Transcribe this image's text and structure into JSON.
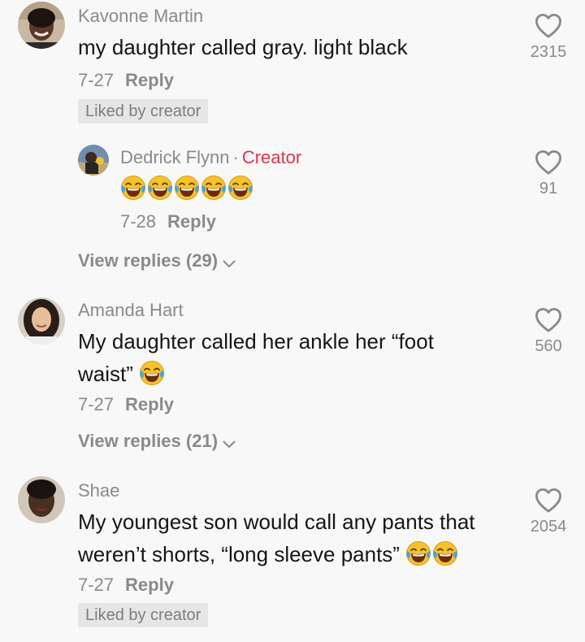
{
  "comments": [
    {
      "author": "Kavonne Martin",
      "text": "my daughter called gray. light black",
      "date": "7-27",
      "reply_label": "Reply",
      "likes": "2315",
      "liked_badge": "Liked by creator"
    },
    {
      "author": "Dedrick Flynn",
      "creator_tag": "Creator",
      "emoji_name": "face-with-tears-of-joy",
      "date": "7-28",
      "reply_label": "Reply",
      "likes": "91"
    },
    {
      "view_replies": "View replies (29)"
    },
    {
      "author": "Amanda Hart",
      "text_line1": "My daughter called her ankle her “foot",
      "text_line2": "waist”",
      "date": "7-27",
      "reply_label": "Reply",
      "likes": "560",
      "view_replies": "View replies (21)"
    },
    {
      "author": "Shae",
      "text_line1": "My youngest son would call any pants that",
      "text_line2": "weren’t shorts, “long sleeve pants”",
      "date": "7-27",
      "reply_label": "Reply",
      "likes": "2054",
      "liked_badge": "Liked by creator"
    }
  ],
  "colors": {
    "background": "#f8f8f8",
    "text": "#161616",
    "muted": "#8a8a8a",
    "creator": "#e0334f",
    "badge_bg": "#e6e6e6"
  }
}
